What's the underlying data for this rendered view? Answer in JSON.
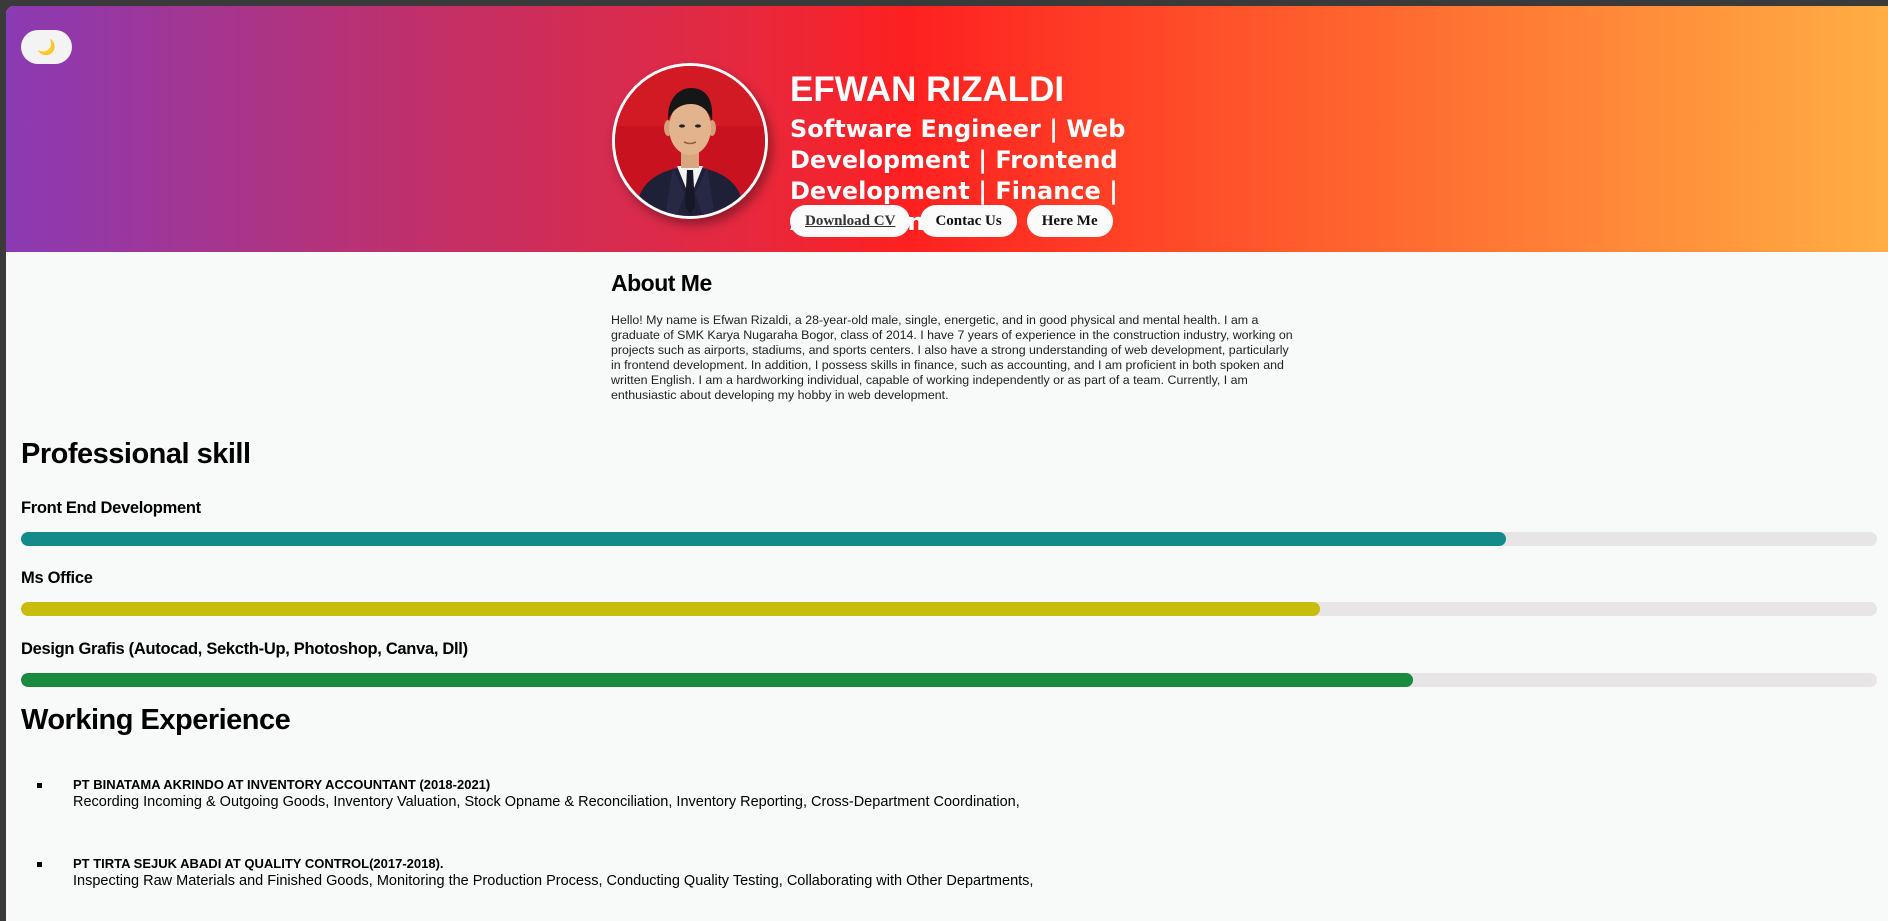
{
  "theme_toggle": {
    "icon": "moon-icon",
    "glyph": "🌙"
  },
  "hero": {
    "name": "EFWAN RIZALDI",
    "role": "Software Engineer | Web Development | Frontend Development | Finance | Accounting",
    "buttons": {
      "download_cv": "Download CV",
      "contact": "Contac Us",
      "hire": "Here Me"
    },
    "avatar": "profile-photo"
  },
  "about": {
    "title": "About Me",
    "text": "Hello! My name is Efwan Rizaldi, a 28-year-old male, single, energetic, and in good physical and mental health. I am a graduate of SMK Karya Nugaraha Bogor, class of 2014. I have 7 years of experience in the construction industry, working on projects such as airports, stadiums, and sports centers. I also have a strong understanding of web development, particularly in frontend development. In addition, I possess skills in finance, such as accounting, and I am proficient in both spoken and written English. I am a hardworking individual, capable of working independently or as part of a team. Currently, I am enthusiastic about developing my hobby in web development."
  },
  "skills": {
    "title": "Professional skill",
    "items": [
      {
        "label": "Front End Development",
        "level": 0.8,
        "color": "#158a8a"
      },
      {
        "label": "Ms Office",
        "level": 0.7,
        "color": "#c9bd0b"
      },
      {
        "label": "Design Grafis (Autocad, Sekcth-Up, Photoshop, Canva, Dll)",
        "level": 0.75,
        "color": "#198a3e"
      }
    ]
  },
  "experience": {
    "title": "Working Experience",
    "items": [
      {
        "heading": "PT BINATAMA AKRINDO AT INVENTORY ACCOUNTANT (2018-2021)",
        "description": "Recording Incoming & Outgoing Goods, Inventory Valuation, Stock Opname & Reconciliation, Inventory Reporting, Cross-Department Coordination,"
      },
      {
        "heading": "PT TIRTA SEJUK ABADI AT QUALITY CONTROL(2017-2018).",
        "description": "Inspecting Raw Materials and Finished Goods, Monitoring the Production Process, Conducting Quality Testing, Collaborating with Other Departments,"
      }
    ]
  }
}
